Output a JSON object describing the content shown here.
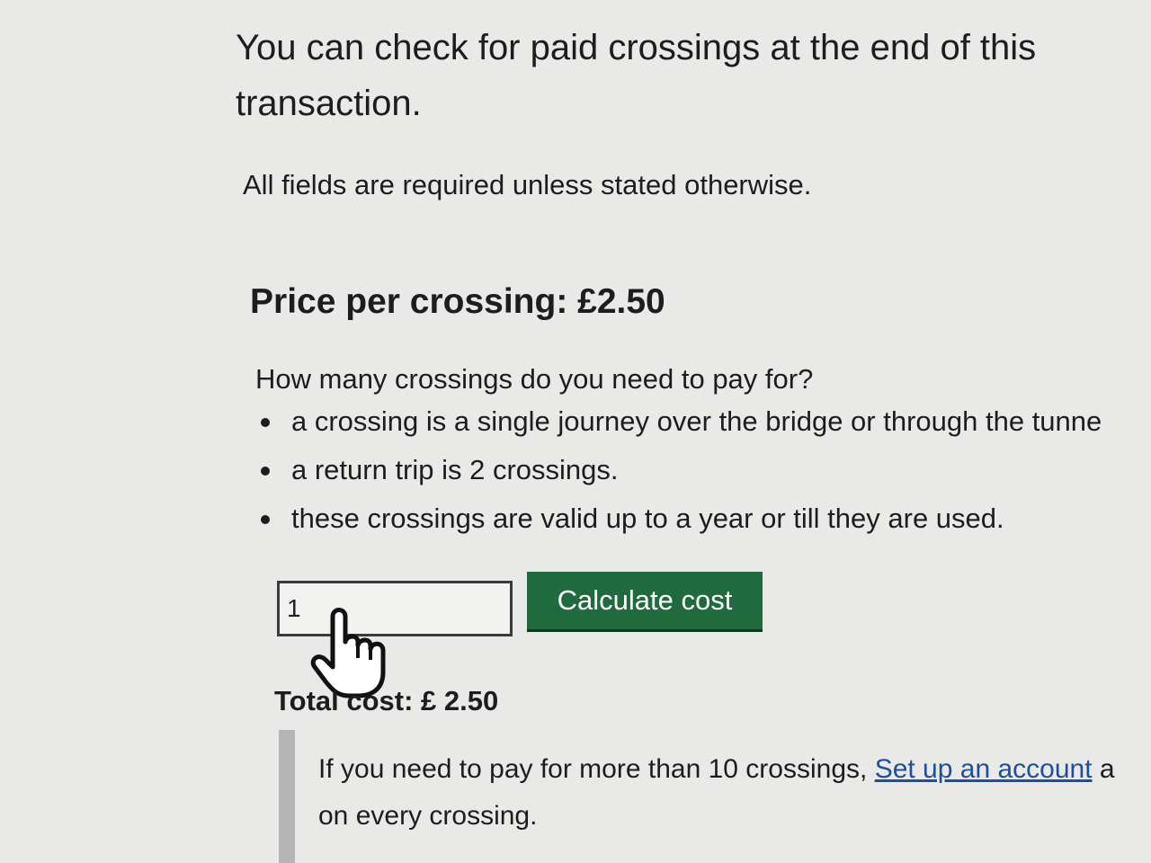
{
  "intro": {
    "text": "You can check for paid crossings at the end of this transaction."
  },
  "required_note": "All fields are required unless stated otherwise.",
  "price": {
    "heading": "Price per crossing: £2.50"
  },
  "question": {
    "text": "How many crossings do you need to pay for?",
    "bullets": [
      "a crossing is a single journey over the bridge or through the tunne",
      "a return trip is 2 crossings.",
      "these crossings are valid up to a year or till they are used."
    ]
  },
  "form": {
    "quantity_value": "1",
    "calculate_label": "Calculate cost"
  },
  "total": {
    "text": "Total cost: £ 2.50"
  },
  "inset": {
    "text_before": "If you need to pay for more than 10 crossings, ",
    "link_text": "Set up an account",
    "text_after": " a",
    "line2": "on every crossing."
  },
  "colors": {
    "button": "#1f6b3d",
    "link": "#1d4f9e",
    "inset_border": "#b5b5b5"
  },
  "icons": {
    "cursor": "hand-pointer-icon"
  }
}
